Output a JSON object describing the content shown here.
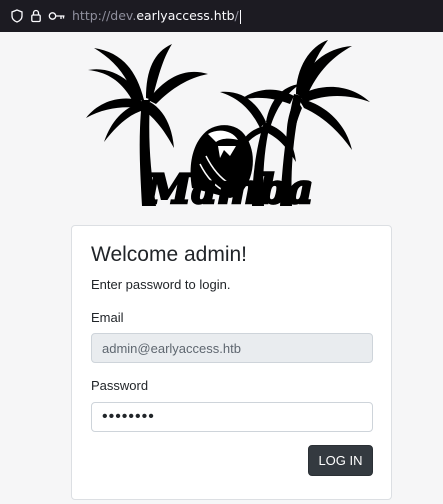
{
  "browser": {
    "url_prefix": "http://dev.",
    "url_host": "earlyaccess.htb",
    "url_suffix": "/",
    "icons": [
      "shield-icon",
      "lock-icon",
      "key-icon"
    ]
  },
  "logo": {
    "text": "Mamba"
  },
  "login": {
    "title": "Welcome admin!",
    "subtitle": "Enter password to login.",
    "email_label": "Email",
    "email_value": "admin@earlyaccess.htb",
    "password_label": "Password",
    "password_value": "password",
    "submit_label": "LOG IN"
  },
  "colors": {
    "url_bar_bg": "#1c1b22",
    "page_bg": "#f6f6f7",
    "button_bg": "#343a40",
    "readonly_input_bg": "#e9ecef"
  }
}
